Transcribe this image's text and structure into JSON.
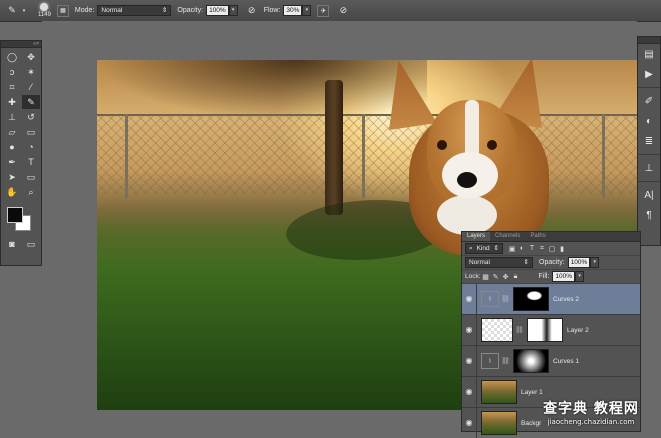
{
  "options_bar": {
    "brush_size": "1149",
    "mode_label": "Mode:",
    "mode_value": "Normal",
    "opacity_label": "Opacity:",
    "opacity_value": "100%",
    "flow_label": "Flow:",
    "flow_value": "30%"
  },
  "toolbox": {
    "foreground_color": "#0a0a0a",
    "background_color": "#ffffff"
  },
  "layers_panel": {
    "tabs": [
      "Layers",
      "Channels",
      "Paths"
    ],
    "active_tab": "Layers",
    "filter_label": "Kind",
    "blend_mode": "Normal",
    "opacity_label": "Opacity:",
    "opacity_value": "100%",
    "lock_label": "Lock:",
    "fill_label": "Fill:",
    "fill_value": "100%",
    "layers": [
      {
        "name": "Curves 2",
        "selected": true
      },
      {
        "name": "Layer 2",
        "selected": false
      },
      {
        "name": "Curves 1",
        "selected": false
      },
      {
        "name": "Layer 1",
        "selected": false
      },
      {
        "name": "Backgr",
        "selected": false
      }
    ]
  },
  "watermark": {
    "line1": "查字典 教程网",
    "line2": "jiaocheng.chazidian.com"
  }
}
